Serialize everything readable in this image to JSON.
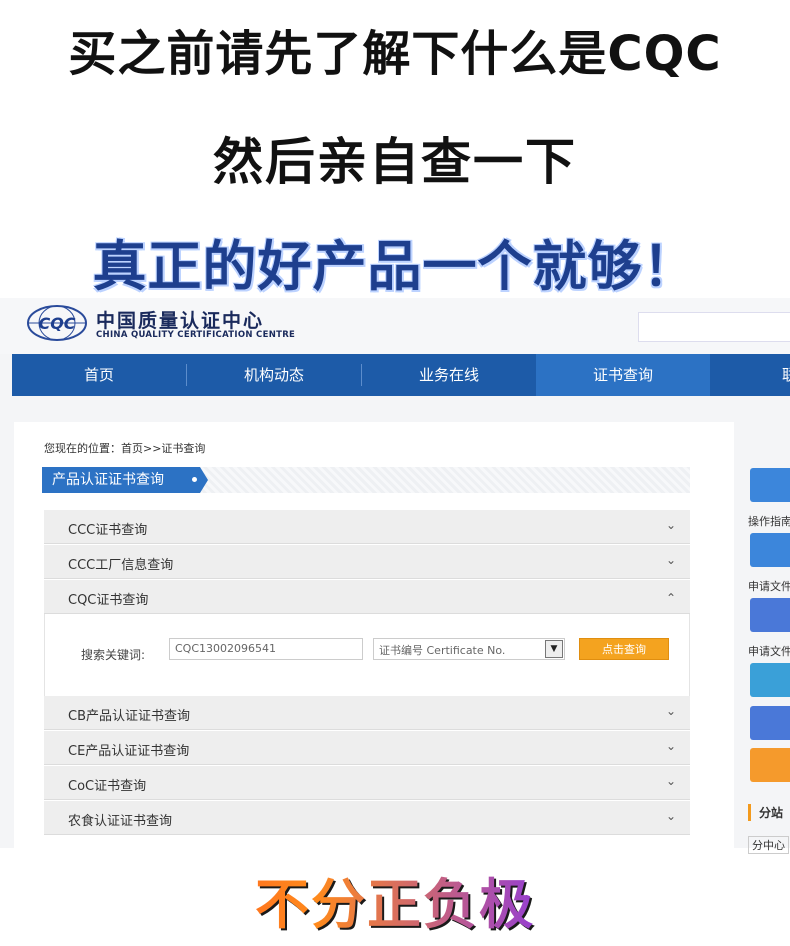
{
  "promo": {
    "line1": "买之前请先了解下什么是CQC",
    "line2": "然后亲自查一下",
    "line3": "真正的好产品一个就够！",
    "bottom": "不分正负极"
  },
  "site": {
    "logo_text": "CQC",
    "org_name_cn": "中国质量认证中心",
    "org_name_en": "CHINA QUALITY CERTIFICATION CENTRE",
    "nav": [
      {
        "label": "首页"
      },
      {
        "label": "机构动态"
      },
      {
        "label": "业务在线"
      },
      {
        "label": "证书查询"
      },
      {
        "label": "联系"
      }
    ],
    "breadcrumb": "您现在的位置：首页>>证书查询",
    "section_title": "产品认证证书查询",
    "accordion": [
      {
        "label": "CCC证书查询",
        "chevron": "⌄"
      },
      {
        "label": "CCC工厂信息查询",
        "chevron": "⌄"
      },
      {
        "label": "CQC证书查询",
        "chevron": "⌃"
      },
      {
        "label": "CB产品认证证书查询",
        "chevron": "⌄"
      },
      {
        "label": "CE产品认证证书查询",
        "chevron": "⌄"
      },
      {
        "label": "CoC证书查询",
        "chevron": "⌄"
      },
      {
        "label": "农食认证证书查询",
        "chevron": "⌄"
      }
    ],
    "search": {
      "keyword_label": "搜索关键词:",
      "keyword_value": "CQC13002096541",
      "type_selected": "证书编号 Certificate No.",
      "submit_label": "点击查询"
    },
    "right_labels": [
      "操作指南",
      "申请文件",
      "申请文件",
      "分站",
      "分中心"
    ]
  },
  "colors": {
    "nav_bg": "#1d5ba8",
    "nav_active": "#2c72c4",
    "button_orange": "#f4a31f",
    "headline_blue": "#1e3f8e"
  }
}
